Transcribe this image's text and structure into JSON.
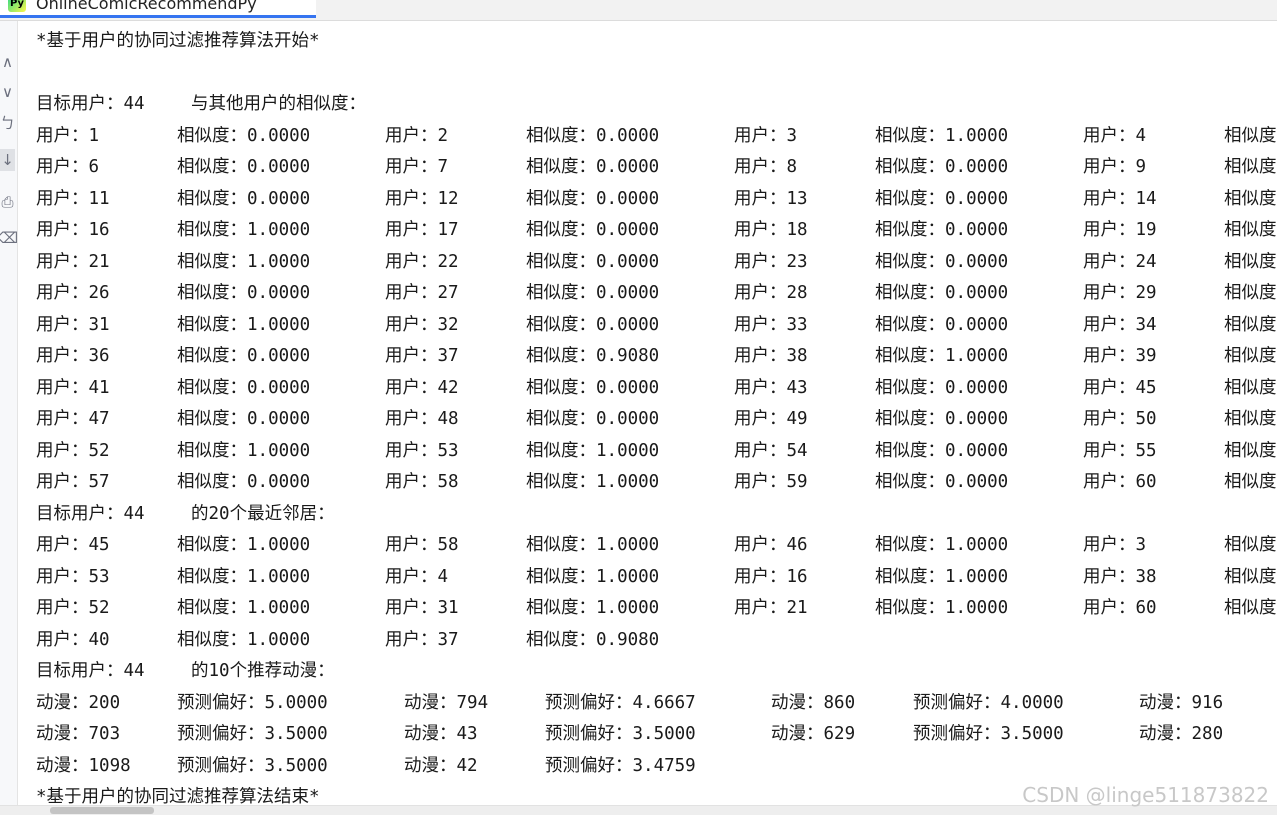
{
  "window": {
    "tab_title": "OnlineComicRecommendPy",
    "tab_icon_label": "Py"
  },
  "console": {
    "header": "*基于用户的协同过滤推荐算法开始*",
    "target_line": [
      "目标用户：44",
      "与其他用户的相似度："
    ],
    "similarity_rows": [
      [
        "用户：1",
        "相似度：0.0000",
        "用户：2",
        "相似度：0.0000",
        "用户：3",
        "相似度：1.0000",
        "用户：4",
        "相似度"
      ],
      [
        "用户：6",
        "相似度：0.0000",
        "用户：7",
        "相似度：0.0000",
        "用户：8",
        "相似度：0.0000",
        "用户：9",
        "相似度"
      ],
      [
        "用户：11",
        "相似度：0.0000",
        "用户：12",
        "相似度：0.0000",
        "用户：13",
        "相似度：0.0000",
        "用户：14",
        "相似度"
      ],
      [
        "用户：16",
        "相似度：1.0000",
        "用户：17",
        "相似度：0.0000",
        "用户：18",
        "相似度：0.0000",
        "用户：19",
        "相似度"
      ],
      [
        "用户：21",
        "相似度：1.0000",
        "用户：22",
        "相似度：0.0000",
        "用户：23",
        "相似度：0.0000",
        "用户：24",
        "相似度"
      ],
      [
        "用户：26",
        "相似度：0.0000",
        "用户：27",
        "相似度：0.0000",
        "用户：28",
        "相似度：0.0000",
        "用户：29",
        "相似度"
      ],
      [
        "用户：31",
        "相似度：1.0000",
        "用户：32",
        "相似度：0.0000",
        "用户：33",
        "相似度：0.0000",
        "用户：34",
        "相似度"
      ],
      [
        "用户：36",
        "相似度：0.0000",
        "用户：37",
        "相似度：0.9080",
        "用户：38",
        "相似度：1.0000",
        "用户：39",
        "相似度"
      ],
      [
        "用户：41",
        "相似度：0.0000",
        "用户：42",
        "相似度：0.0000",
        "用户：43",
        "相似度：0.0000",
        "用户：45",
        "相似度"
      ],
      [
        "用户：47",
        "相似度：0.0000",
        "用户：48",
        "相似度：0.0000",
        "用户：49",
        "相似度：0.0000",
        "用户：50",
        "相似度"
      ],
      [
        "用户：52",
        "相似度：1.0000",
        "用户：53",
        "相似度：1.0000",
        "用户：54",
        "相似度：0.0000",
        "用户：55",
        "相似度"
      ],
      [
        "用户：57",
        "相似度：0.0000",
        "用户：58",
        "相似度：1.0000",
        "用户：59",
        "相似度：0.0000",
        "用户：60",
        "相似度"
      ]
    ],
    "neighbors_line": [
      "目标用户：44",
      "的20个最近邻居："
    ],
    "neighbor_rows": [
      [
        "用户：45",
        "相似度：1.0000",
        "用户：58",
        "相似度：1.0000",
        "用户：46",
        "相似度：1.0000",
        "用户：3",
        "相似度"
      ],
      [
        "用户：53",
        "相似度：1.0000",
        "用户：4",
        "相似度：1.0000",
        "用户：16",
        "相似度：1.0000",
        "用户：38",
        "相似度"
      ],
      [
        "用户：52",
        "相似度：1.0000",
        "用户：31",
        "相似度：1.0000",
        "用户：21",
        "相似度：1.0000",
        "用户：60",
        "相似度"
      ],
      [
        "用户：40",
        "相似度：1.0000",
        "用户：37",
        "相似度：0.9080"
      ]
    ],
    "recommend_line": [
      "目标用户：44",
      "的10个推荐动漫："
    ],
    "recommend_rows": [
      [
        "动漫：200",
        "预测偏好：5.0000",
        "动漫：794",
        "预测偏好：4.6667",
        "动漫：860",
        "预测偏好：4.0000",
        "动漫：916"
      ],
      [
        "动漫：703",
        "预测偏好：3.5000",
        "动漫：43",
        "预测偏好：3.5000",
        "动漫：629",
        "预测偏好：3.5000",
        "动漫：280"
      ],
      [
        "动漫：1098",
        "预测偏好：3.5000",
        "动漫：42",
        "预测偏好：3.4759"
      ]
    ],
    "footer": "*基于用户的协同过滤推荐算法结束*"
  },
  "gutter": {
    "icons": [
      "chevron-up-icon",
      "chevron-down-icon",
      "soft-wrap-icon",
      "scroll-to-end-icon",
      "print-icon",
      "delete-icon"
    ],
    "glyphs": [
      "∧",
      "∨",
      "ㄅ",
      "↓",
      "⎙",
      "⌫"
    ]
  },
  "watermark": "CSDN @linge511873822"
}
